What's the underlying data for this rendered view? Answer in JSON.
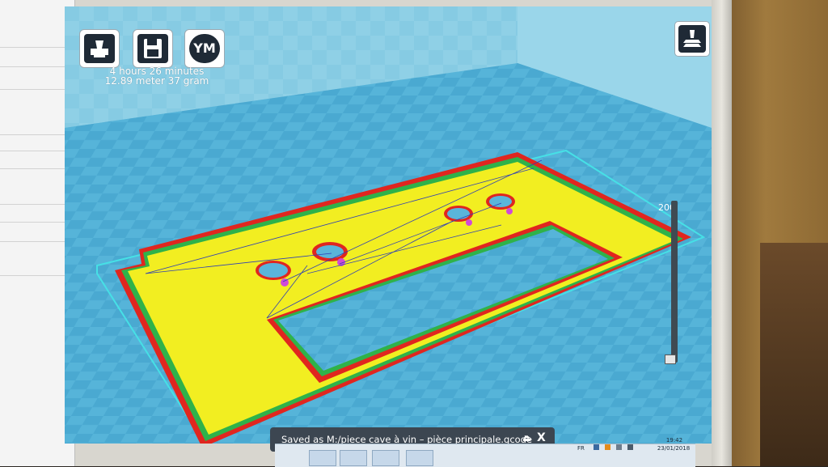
{
  "toolbar": {
    "load_icon": "load-model-icon",
    "save_icon": "save-gcode-icon",
    "account_initials": "YM"
  },
  "print_info": {
    "time": "4 hours 26 minutes",
    "material": "12.89 meter 37 gram"
  },
  "view_mode_icon": "view-mode-icon",
  "layer_slider": {
    "max_label": "200",
    "current_layer": 1,
    "max_layer": 200
  },
  "notification": {
    "message": "Saved as M:/piece cave à vin – pièce principale.gcode",
    "eject_glyph": "⏏",
    "close_glyph": "X"
  },
  "tray": {
    "language": "FR",
    "time": "19:42",
    "date": "23/01/2018"
  },
  "colors": {
    "bed": "#5ab5da",
    "part_fill": "#f2ee21",
    "outer_wall": "#e0261f",
    "inner_wall": "#2fb24a",
    "travel": "#2f3fb5"
  }
}
